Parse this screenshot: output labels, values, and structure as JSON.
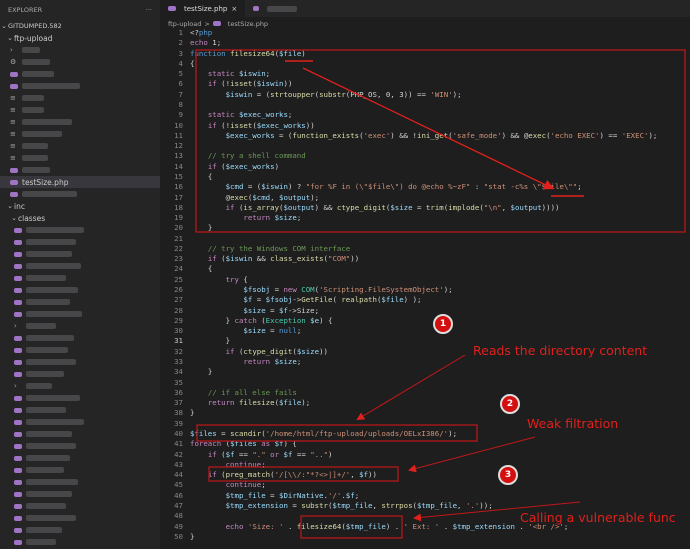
{
  "sidebar": {
    "title": "EXPLORER",
    "more": "···",
    "root": "GITDUMPED.582",
    "folder": "ftp-upload",
    "selected_file": "testSize.php",
    "inc": "inc",
    "classes": "classes"
  },
  "tabs": [
    {
      "label": "testSize.php",
      "close": "×"
    }
  ],
  "breadcrumb": {
    "folder": "ftp-upload",
    "sep": ">",
    "file": "testSize.php"
  },
  "code": [
    "<?php",
    "echo 1;",
    "function filesize64($file)",
    "{",
    "    static $iswin;",
    "    if (!isset($iswin))",
    "        $iswin = (strtoupper(substr(PHP_OS, 0, 3)) == 'WIN');",
    "",
    "    static $exec_works;",
    "    if (!isset($exec_works))",
    "        $exec_works = (function_exists('exec') && !ini_get('safe_mode') && @exec('echo EXEC') == 'EXEC');",
    "",
    "    // try a shell command",
    "    if ($exec_works)",
    "    {",
    "        $cmd = ($iswin) ? \"for %F in (\\\"$file\\\") do @echo %~zF\" : \"stat -c%s \\\"$file\\\"\";",
    "        @exec($cmd, $output);",
    "        if (is_array($output) && ctype_digit($size = trim(implode(\"\\n\", $output))))",
    "            return $size;",
    "    }",
    "",
    "    // try the Windows COM interface",
    "    if ($iswin && class_exists(\"COM\"))",
    "    {",
    "        try {",
    "            $fsobj = new COM('Scripting.FileSystemObject');",
    "            $f = $fsobj->GetFile( realpath($file) );",
    "            $size = $f->Size;",
    "        } catch (Exception $e) {",
    "            $size = null;",
    "        }",
    "        if (ctype_digit($size))",
    "            return $size;",
    "    }",
    "",
    "    // if all else fails",
    "    return filesize($file);",
    "}",
    "",
    "$files = scandir('/home/html/ftp-upload/uploads/OELxI386/');",
    "foreach ($files as $f) {",
    "    if ($f == \".\" or $f == \"..\")",
    "        continue;",
    "    if (preg_match('/[\\\\/:\"*?<>|]+/', $f))",
    "        continue;",
    "        $tmp_file = $DirNative.'/'.$f;",
    "        $tmp_extension = substr($tmp_file, strrpos($tmp_file, '.'));",
    "",
    "        echo 'Size: ' . filesize64($tmp_file) . ' Ext: ' . $tmp_extension . '<br />';",
    "}"
  ],
  "current_line": 31,
  "annotations": [
    {
      "badge": "1",
      "text": "Reads the directory content"
    },
    {
      "badge": "2",
      "text": "Weak filtration"
    },
    {
      "badge": "3",
      "text": "Calling a vulnerable func"
    }
  ],
  "colors": {
    "annotation": "#e0201c",
    "background": "#1e1e1e",
    "sidebar": "#252526"
  }
}
